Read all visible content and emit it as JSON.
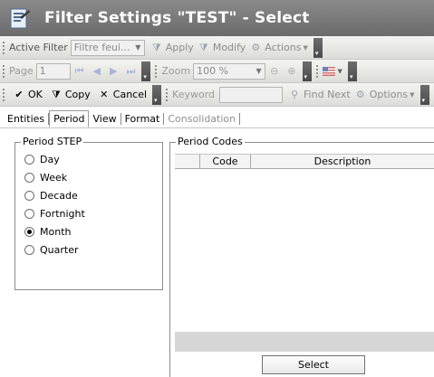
{
  "window": {
    "title": "Filter Settings \"TEST\" - Select"
  },
  "toolbar1": {
    "active_filter_label": "Active Filter",
    "filter_value": "Filtre feui...",
    "apply_label": "Apply",
    "modify_label": "Modify",
    "actions_label": "Actions"
  },
  "toolbar2": {
    "page_label": "Page",
    "page_value": "1",
    "zoom_label": "Zoom",
    "zoom_value": "100 %"
  },
  "toolbar3": {
    "ok_label": "OK",
    "copy_label": "Copy",
    "cancel_label": "Cancel",
    "keyword_label": "Keyword",
    "keyword_value": "",
    "find_next_label": "Find Next",
    "options_label": "Options"
  },
  "tabs": [
    {
      "label": "Entities",
      "state": "normal"
    },
    {
      "label": "Period",
      "state": "active"
    },
    {
      "label": "View",
      "state": "normal"
    },
    {
      "label": "Format",
      "state": "normal"
    },
    {
      "label": "Consolidation",
      "state": "disabled"
    }
  ],
  "period_step": {
    "title": "Period STEP",
    "options": [
      "Day",
      "Week",
      "Decade",
      "Fortnight",
      "Month",
      "Quarter"
    ],
    "selected": "Month"
  },
  "period_codes": {
    "title": "Period Codes",
    "columns": [
      "Code",
      "Description"
    ],
    "rows": []
  },
  "select_button": "Select",
  "colors": {
    "titlebar": "#7a7a7a",
    "title_text": "#ffffff",
    "disabled_text": "#8d8d8d"
  }
}
